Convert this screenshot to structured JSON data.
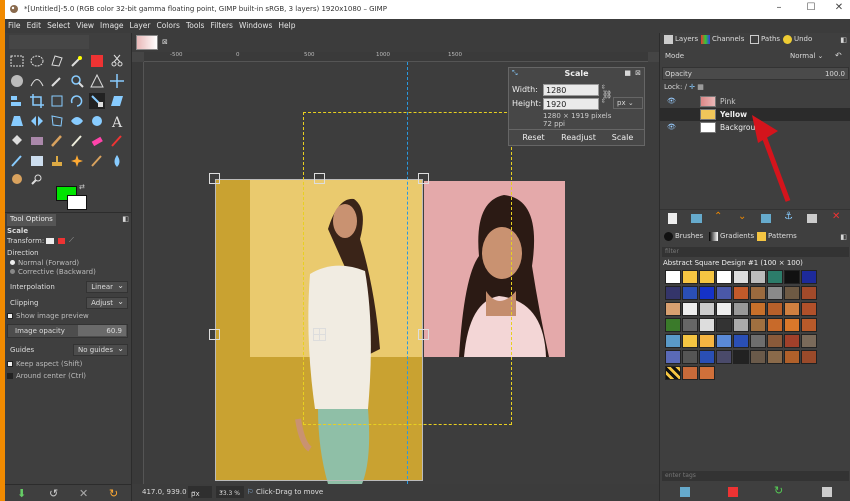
{
  "window": {
    "title": "*[Untitled]-5.0 (RGB color 32-bit gamma floating point, GIMP built-in sRGB, 3 layers) 1920x1080 – GIMP",
    "controls": [
      "–",
      "☐",
      "✕"
    ]
  },
  "menu": [
    "File",
    "Edit",
    "Select",
    "View",
    "Image",
    "Layer",
    "Colors",
    "Tools",
    "Filters",
    "Windows",
    "Help"
  ],
  "tool_options": {
    "tab_label": "Tool Options",
    "title": "Scale",
    "transform_label": "Transform:",
    "direction_label": "Direction",
    "direction_normal": "Normal (Forward)",
    "direction_corrective": "Corrective (Backward)",
    "interpolation_label": "Interpolation",
    "interpolation_value": "Linear",
    "clipping_label": "Clipping",
    "clipping_value": "Adjust",
    "show_preview": "Show image preview",
    "image_opacity_label": "Image opacity",
    "image_opacity_value": "60.9",
    "guides_label": "Guides",
    "guides_value": "No guides",
    "keep_aspect": "Keep aspect (Shift)",
    "around_center": "Around center (Ctrl)"
  },
  "ruler_ticks": [
    "-500",
    "0",
    "500",
    "1000",
    "1500"
  ],
  "scale_dialog": {
    "title": "Scale",
    "width_label": "Width:",
    "width_value": "1280",
    "height_label": "Height:",
    "height_value": "1920",
    "unit": "px",
    "info_pixels": "1280 × 1919 pixels",
    "info_ppi": "72 ppi",
    "reset": "Reset",
    "readjust": "Readjust",
    "scale": "Scale"
  },
  "status_bar": {
    "coords": "417.0, 939.0",
    "unit": "px",
    "zoom": "33.3 %",
    "message": "Click-Drag to move"
  },
  "layers_panel": {
    "tabs": [
      "Layers",
      "Channels",
      "Paths",
      "Undo"
    ],
    "mode_label": "Mode",
    "mode_value": "Normal",
    "opacity_label": "Opacity",
    "opacity_value": "100.0",
    "lock_label": "Lock:",
    "layers": [
      {
        "name": "Pink",
        "visible": true,
        "active": false
      },
      {
        "name": "Yellow",
        "visible": false,
        "active": true
      },
      {
        "name": "Background",
        "visible": true,
        "active": false
      }
    ]
  },
  "brushes_panel": {
    "tabs": [
      "Brushes",
      "Gradients",
      "Patterns"
    ],
    "filter_placeholder": "filter",
    "pattern_name": "Abstract Square Design #1 (100 × 100)",
    "tags_placeholder": "enter tags"
  },
  "colors": {
    "foreground": "#00e500",
    "background": "#ffffff",
    "accent": "#f18a00",
    "arrow": "#d4141c"
  }
}
